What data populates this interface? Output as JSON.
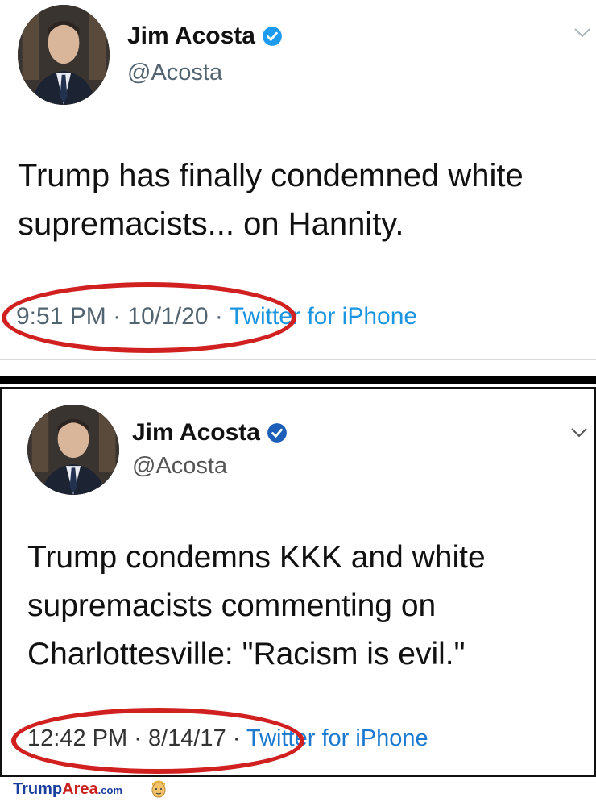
{
  "tweets": [
    {
      "name": "Jim Acosta",
      "handle": "@Acosta",
      "text_lines": [
        "Trump has finally condemned white",
        "supremacists... on Hannity."
      ],
      "time": "9:51 PM",
      "date": "10/1/20",
      "source": "Twitter for iPhone"
    },
    {
      "name": "Jim Acosta",
      "handle": "@Acosta",
      "text_lines": [
        "Trump condemns KKK and white",
        "supremacists commenting on",
        "Charlottesville: \"Racism is evil.\""
      ],
      "time": "12:42 PM",
      "date": "8/14/17",
      "source": "Twitter for iPhone"
    }
  ],
  "separator": "·",
  "watermark": {
    "brand_part1": "Trump",
    "brand_part2": "Area",
    "brand_suffix": ".com"
  },
  "colors": {
    "highlight": "#d02020",
    "link": "#1b95e0",
    "verified": "#1d9bf0",
    "muted": "#536471"
  },
  "icons": {
    "verified": "verified-badge-icon",
    "more": "chevron-down-icon",
    "watermark": "trump-face-icon"
  }
}
